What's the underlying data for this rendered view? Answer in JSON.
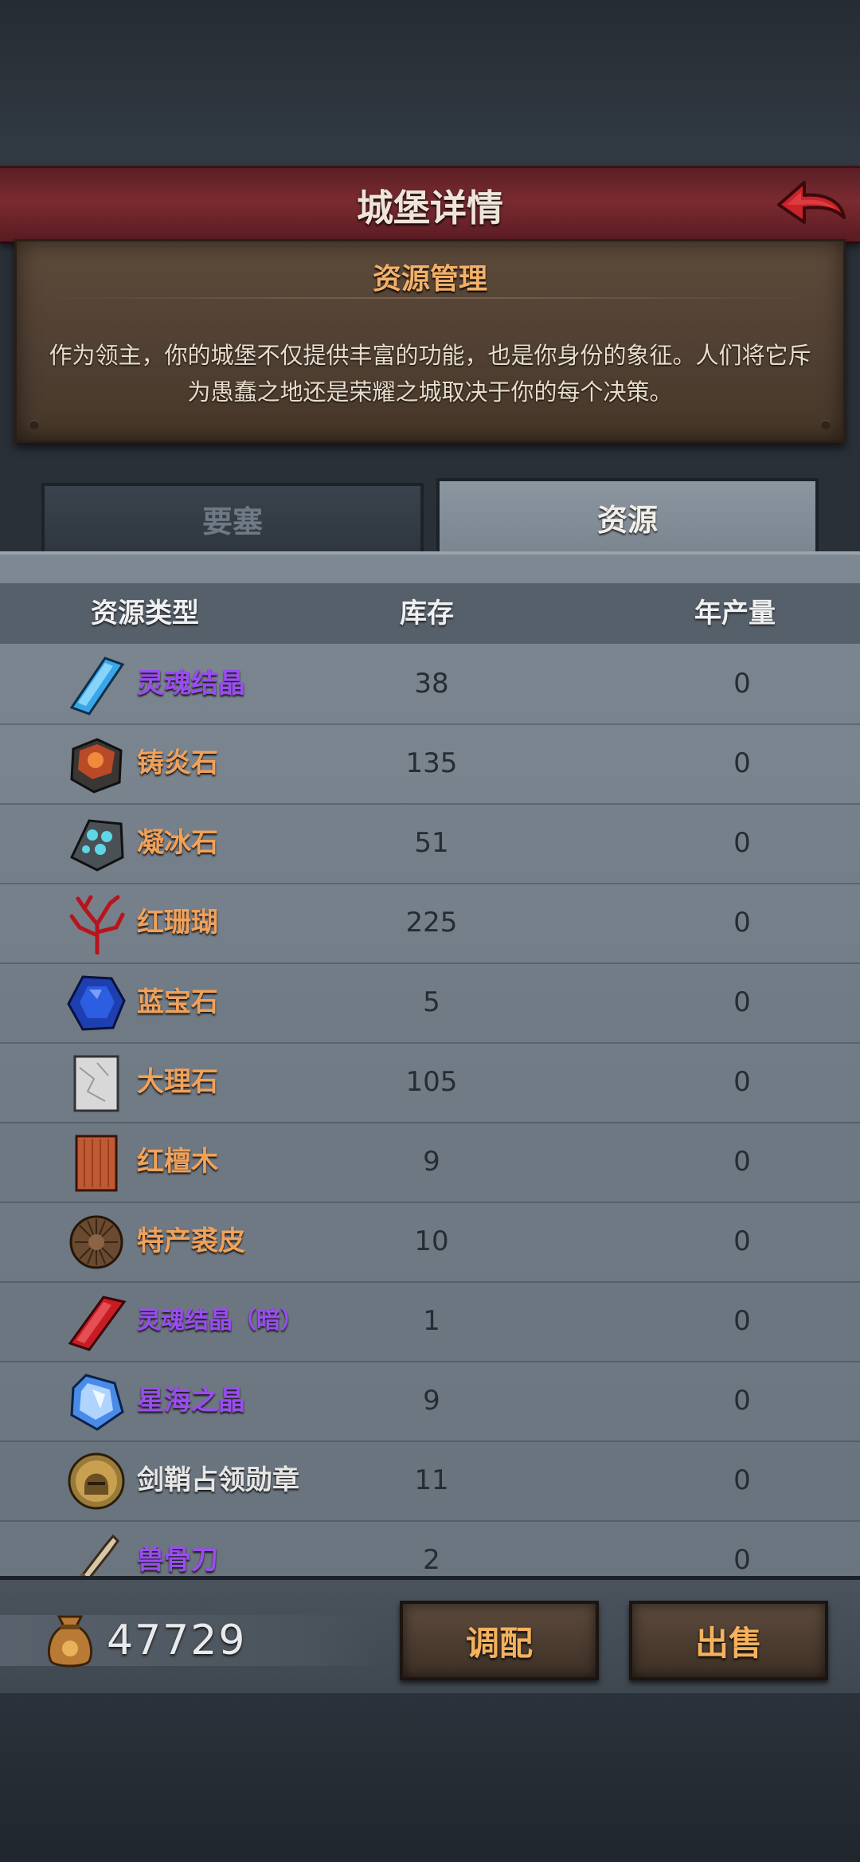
{
  "header": {
    "title": "城堡详情",
    "back_icon": "red-back-arrow-icon"
  },
  "info": {
    "title": "资源管理",
    "description": "作为领主，你的城堡不仅提供丰富的功能，也是你身份的象征。人们将它斥为愚蠢之地还是荣耀之城取决于你的每个决策。"
  },
  "tabs": [
    {
      "label": "要塞",
      "active": false
    },
    {
      "label": "资源",
      "active": true
    }
  ],
  "table": {
    "columns": [
      "资源类型",
      "库存",
      "年产量"
    ],
    "rows": [
      {
        "name": "灵魂结晶",
        "stock": "38",
        "yearly": "0",
        "color": "#9a4cf0",
        "icon": "blue-soul-crystal-icon"
      },
      {
        "name": "铸炎石",
        "stock": "135",
        "yearly": "0",
        "color": "#f0a15a",
        "icon": "flame-ore-icon"
      },
      {
        "name": "凝冰石",
        "stock": "51",
        "yearly": "0",
        "color": "#f0a15a",
        "icon": "frost-ore-icon"
      },
      {
        "name": "红珊瑚",
        "stock": "225",
        "yearly": "0",
        "color": "#f0a15a",
        "icon": "red-coral-icon"
      },
      {
        "name": "蓝宝石",
        "stock": "5",
        "yearly": "0",
        "color": "#f0a15a",
        "icon": "sapphire-icon"
      },
      {
        "name": "大理石",
        "stock": "105",
        "yearly": "0",
        "color": "#f0a15a",
        "icon": "marble-icon"
      },
      {
        "name": "红檀木",
        "stock": "9",
        "yearly": "0",
        "color": "#f0a15a",
        "icon": "red-sandalwood-icon"
      },
      {
        "name": "特产裘皮",
        "stock": "10",
        "yearly": "0",
        "color": "#f0a15a",
        "icon": "fur-pelt-icon"
      },
      {
        "name": "灵魂结晶（暗）",
        "stock": "1",
        "yearly": "0",
        "color": "#9a4cf0",
        "icon": "dark-soul-crystal-icon"
      },
      {
        "name": "星海之晶",
        "stock": "9",
        "yearly": "0",
        "color": "#9a4cf0",
        "icon": "star-sea-crystal-icon"
      },
      {
        "name": "剑鞘占领勋章",
        "stock": "11",
        "yearly": "0",
        "color": "#e6e6e6",
        "icon": "helmet-medal-icon"
      },
      {
        "name": "兽骨刀",
        "stock": "2",
        "yearly": "0",
        "color": "#9a4cf0",
        "icon": "bone-knife-icon"
      }
    ]
  },
  "footer": {
    "gold_icon": "coin-sack-icon",
    "gold": "47729",
    "allocate_label": "调配",
    "sell_label": "出售"
  },
  "colors": {
    "title_bar": "#7a2a30",
    "accent_orange": "#f0a15a",
    "rare_purple": "#9a4cf0"
  }
}
